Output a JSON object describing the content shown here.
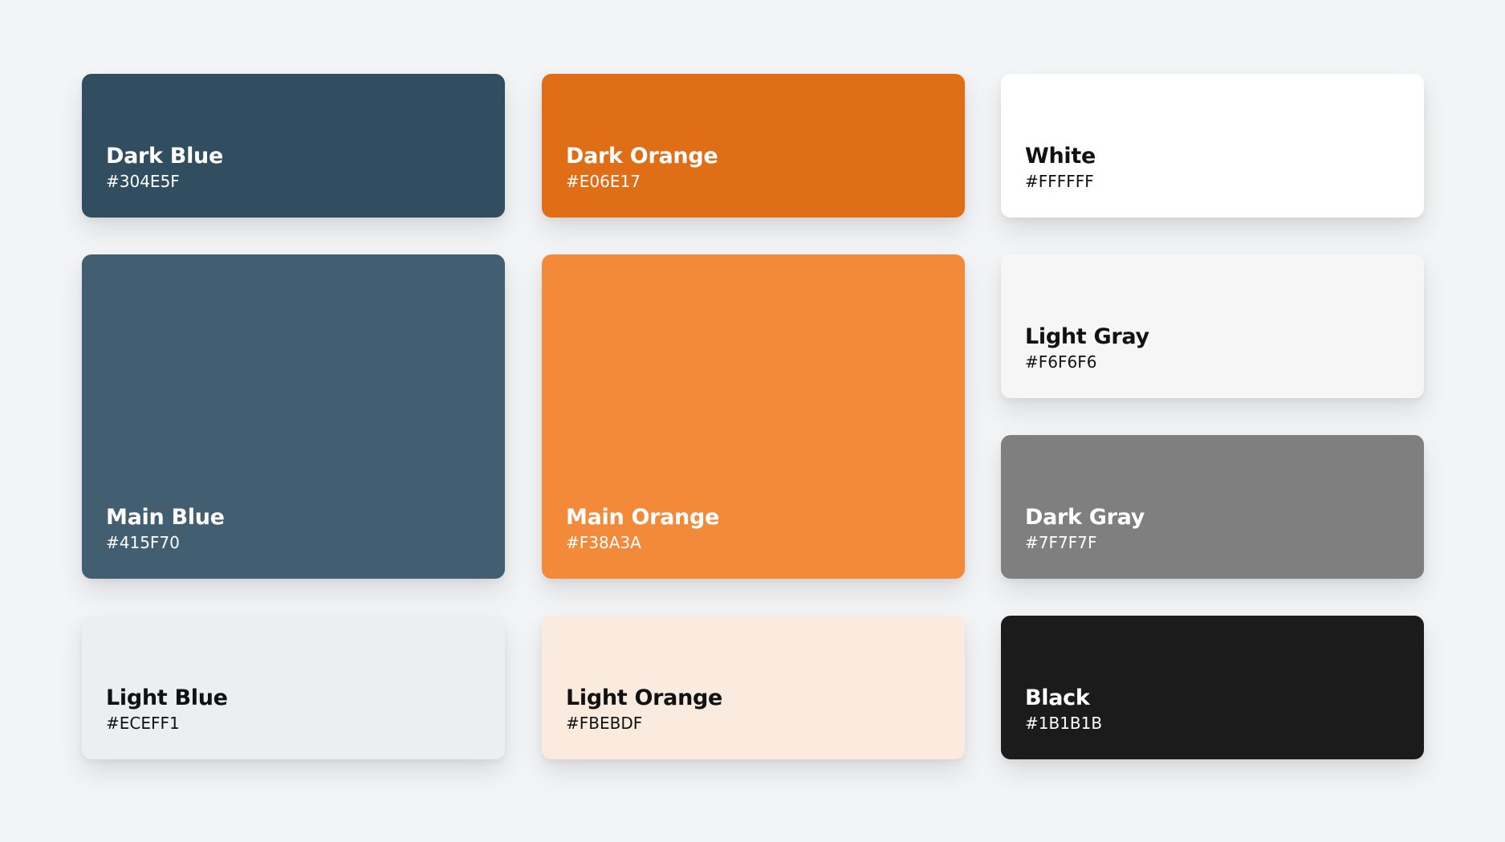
{
  "swatches": [
    {
      "name": "Dark Blue",
      "hex": "#304E5F",
      "color": "#304E5F",
      "text_color": "#FFFFFF"
    },
    {
      "name": "Dark Orange",
      "hex": "#E06E17",
      "color": "#E06E17",
      "text_color": "#FFFFFF"
    },
    {
      "name": "White",
      "hex": "#FFFFFF",
      "color": "#FFFFFF",
      "text_color": "#111111"
    },
    {
      "name": "Main Blue",
      "hex": "#415F70",
      "color": "#415F70",
      "text_color": "#FFFFFF"
    },
    {
      "name": "Main Orange",
      "hex": "#F38A3A",
      "color": "#F38A3A",
      "text_color": "#FFFFFF"
    },
    {
      "name": "Light Gray",
      "hex": "#F6F6F6",
      "color": "#F6F6F6",
      "text_color": "#111111"
    },
    {
      "name": "Dark Gray",
      "hex": "#7F7F7F",
      "color": "#7F7F7F",
      "text_color": "#FFFFFF"
    },
    {
      "name": "Light Blue",
      "hex": "#ECEFF1",
      "color": "#ECEFF1",
      "text_color": "#111111"
    },
    {
      "name": "Light Orange",
      "hex": "#FBEBDF",
      "color": "#FBEBDF",
      "text_color": "#111111"
    },
    {
      "name": "Black",
      "hex": "#1B1B1B",
      "color": "#1B1B1B",
      "text_color": "#FFFFFF"
    }
  ]
}
